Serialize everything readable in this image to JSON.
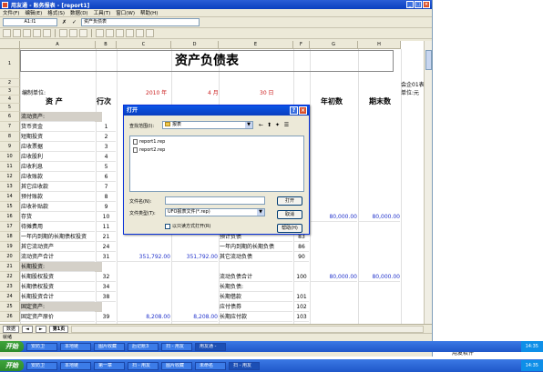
{
  "window": {
    "title": "用友通 - 账务报表 - [report1]",
    "menu": [
      "文件(F)",
      "编辑(E)",
      "格式(S)",
      "数据(D)",
      "工具(T)",
      "窗口(W)",
      "帮助(H)"
    ]
  },
  "formula_bar": {
    "cell_ref": "A1:I1",
    "cancel": "✗",
    "confirm": "✓",
    "content": "资产负债表"
  },
  "columns": [
    "A",
    "B",
    "C",
    "D",
    "E",
    "F",
    "G",
    "H"
  ],
  "sheet": {
    "title": "资产负债表",
    "company_label": "会企01表",
    "unit_label": "编制单位:",
    "currency_label": "单位:元",
    "year": "2010 年",
    "month": "4 月",
    "day": "30 日",
    "header_asset": "资    产",
    "header_row_no": "行次",
    "header_begin": "年初数",
    "header_end": "期末数",
    "rows": [
      {
        "no": "1"
      },
      {
        "no": "2"
      },
      {
        "no": "3"
      },
      {
        "no": "4"
      },
      {
        "no": "5"
      },
      {
        "no": "6",
        "a": "流动资产:",
        "grey": true
      },
      {
        "no": "7",
        "a": "  货币资金",
        "b": "1"
      },
      {
        "no": "8",
        "a": "  短期投资",
        "b": "2"
      },
      {
        "no": "9",
        "a": "  应收票据",
        "b": "3"
      },
      {
        "no": "10",
        "a": "  应收股利",
        "b": "4"
      },
      {
        "no": "11",
        "a": "  应收利息",
        "b": "5"
      },
      {
        "no": "12",
        "a": "  应收账款",
        "b": "6"
      },
      {
        "no": "13",
        "a": "  其它应收款",
        "b": "7"
      },
      {
        "no": "14",
        "a": "  预付账款",
        "b": "8"
      },
      {
        "no": "15",
        "a": "  应收补贴款",
        "b": "9"
      },
      {
        "no": "16",
        "a": "  存货",
        "b": "10",
        "g": "80,000.00",
        "h": "80,000.00"
      },
      {
        "no": "17",
        "a": "  待摊费用",
        "b": "11"
      },
      {
        "no": "18",
        "a": "一年内到期的长期债权投资",
        "b": "21",
        "e": "预计负债",
        "f": "83"
      },
      {
        "no": "19",
        "a": "  其它流动资产",
        "b": "24",
        "e": "一年内到期的长期负债",
        "f": "86"
      },
      {
        "no": "20",
        "a": "  流动资产合计",
        "b": "31",
        "c": "351,792.00",
        "d": "351,792.00",
        "e": "其它流动负债",
        "f": "90"
      },
      {
        "no": "21",
        "a": "长期投资:",
        "grey": true
      },
      {
        "no": "22",
        "a": "  长期股权投资",
        "b": "32",
        "e": "流动负债合计",
        "f": "100",
        "g": "80,000.00",
        "h": "80,000.00"
      },
      {
        "no": "23",
        "a": "  长期债权投资",
        "b": "34",
        "e": "长期负债:"
      },
      {
        "no": "24",
        "a": "  长期投资合计",
        "b": "38",
        "e": "  长期借款",
        "f": "101"
      },
      {
        "no": "25",
        "a": "固定资产:",
        "grey": true,
        "e": "  应付债券",
        "f": "102"
      },
      {
        "no": "26",
        "a": "  固定资产原价",
        "b": "39",
        "c": "8,208.00",
        "d": "8,208.00",
        "e": "  长期应付款",
        "f": "103"
      }
    ]
  },
  "sheet_tabs": {
    "nav": "数据",
    "tab": "第1页"
  },
  "status": "就绪",
  "right_pane": {
    "label": "用友软件"
  },
  "dialog": {
    "title": "打开",
    "help": "?",
    "close": "×",
    "look_in_label": "查找范围(I):",
    "look_in_value": "报表",
    "files": [
      "report1.rep",
      "report2.rep"
    ],
    "filename_label": "文件名(N):",
    "filename_value": "",
    "filetype_label": "文件类型(T):",
    "filetype_value": "UFO报表文件(*.rep)",
    "readonly_label": "以只读方式打开(R)",
    "open_button": "打开",
    "cancel_button": "取消",
    "help_button": "帮助(H)"
  },
  "taskbars": [
    {
      "start": "开始",
      "tasks": [
        "安防卫",
        "本地链",
        "图片收藏",
        "后记账3",
        "扫 - 用友",
        "用友通 -"
      ],
      "active_index": 5,
      "clock": "14:35"
    },
    {
      "start": "开始",
      "tasks": [
        "安防卫",
        "本地链",
        "第一章",
        "扫 - 用友",
        "图片收藏",
        "未命名",
        "扫 - 用友"
      ],
      "active_index": 6,
      "clock": "14:35"
    }
  ]
}
